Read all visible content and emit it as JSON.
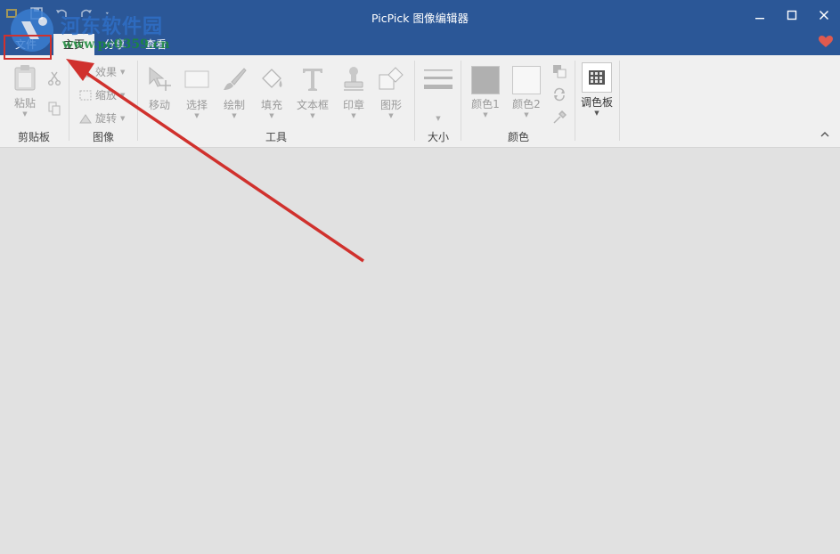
{
  "window": {
    "title": "PicPick 图像编辑器",
    "controls": [
      "minimize",
      "maximize",
      "close"
    ]
  },
  "tabs": [
    {
      "label": "文件",
      "active": false
    },
    {
      "label": "主页",
      "active": true
    },
    {
      "label": "分享",
      "active": false
    },
    {
      "label": "查看",
      "active": false
    }
  ],
  "ribbon": {
    "clipboard": {
      "group_label": "剪贴板",
      "paste": "粘贴"
    },
    "image": {
      "group_label": "图像",
      "effects": "效果",
      "resize": "缩放",
      "rotate": "旋转"
    },
    "tools": {
      "group_label": "工具",
      "move": "移动",
      "select": "选择",
      "draw": "绘制",
      "fill": "填充",
      "textbox": "文本框",
      "stamp": "印章",
      "shape": "图形"
    },
    "size": {
      "group_label": "大小"
    },
    "colors": {
      "group_label": "颜色",
      "color1": "颜色1",
      "color2": "颜色2"
    },
    "palette": {
      "label": "调色板"
    }
  },
  "watermark": {
    "text": "河东软件园",
    "url": "www.pc0359.cn"
  },
  "colors": {
    "titlebar": "#2b5797",
    "annotation": "#d0312d",
    "heart": "#e05a4f"
  }
}
